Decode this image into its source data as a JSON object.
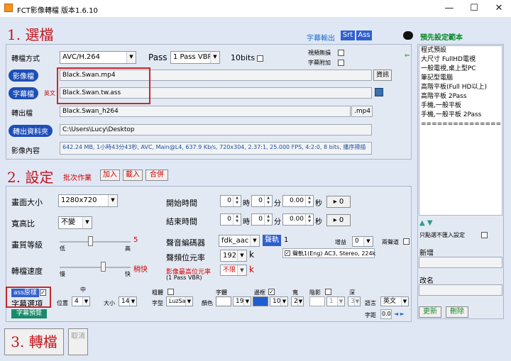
{
  "window": {
    "title": "FCT影像轉檔 版本1.6.10",
    "minimize": "—",
    "maximize": "☐",
    "close": "✕"
  },
  "section1": {
    "title": "1. 選檔",
    "subtitle_output_label": "字幕輸出",
    "srt_label": "Srt",
    "ass_label": "Ass",
    "format_label": "轉檔方式",
    "format_value": "AVC/H.264",
    "pass_label": "Pass",
    "pass_value": "1 Pass VBR",
    "bits_label": "10bits",
    "no_video_label": "視頻無損",
    "add_sub_label": "字幕附加",
    "video_file_label": "影像檔",
    "video_file_value": "Black.Swan.mp4",
    "info_button": "資訊",
    "subtitle_file_label": "字幕檔",
    "subtitle_lang": "英文",
    "subtitle_file_value": "Black.Swan.tw.ass",
    "output_file_label": "轉出檔",
    "output_file_value": "Black.Swan_h264",
    "output_ext": ".mp4",
    "output_folder_label": "轉出資料夾",
    "output_folder_value": "C:\\Users\\Lucy\\Desktop",
    "media_info_label": "影像內容",
    "media_info_value": "642.24 MB, 1小時43分43秒, AVC, Main@L4, 637.9 Kb/s, 720x304, 2.37:1, 25.000 FPS, 4:2:0, 8 bits, 播序掃描"
  },
  "presets": {
    "title": "預先設定範本",
    "items": [
      "程式預設",
      "大尺寸 FullHD電視",
      "一般電視,桌上型PC",
      "筆記型電腦",
      "高階平板(Full HD以上)",
      "高階平板 2Pass",
      "手機,一般平板",
      "手機,一般平板 2Pass",
      "==============="
    ],
    "up_down": "▲ ▼",
    "only_selected_label": "只點選不匯入設定",
    "new_label": "新增",
    "rename_label": "改名",
    "update_button": "更新",
    "delete_button": "刪除"
  },
  "section2": {
    "title": "2. 設定",
    "batch_label": "批次作業",
    "add_button": "加入",
    "load_button": "載入",
    "merge_button": "合併",
    "size_label": "畫面大小",
    "size_value": "1280x720",
    "aspect_label": "寬高比",
    "aspect_value": "不變",
    "quality_label": "畫質等級",
    "quality_value": "5",
    "low_label": "低",
    "high_label": "高",
    "speed_label": "轉檔速度",
    "speed_value": "稍快",
    "slow_label": "慢",
    "fast_label": "快",
    "start_label": "開始時間",
    "end_label": "結束時間",
    "hour": "時",
    "minute": "分",
    "second": "秒",
    "zero": "0",
    "sec_zero": "0.00",
    "go_label": "▸ 0",
    "encoder_label": "聲音編碼器",
    "encoder_value": "fdk_aac",
    "audio_track_label": "聲軌",
    "audio_track_num": "1",
    "gain_label": "增益",
    "gain_value": "0",
    "two_ch_label": "兩聲道",
    "bitrate_label": "聲頻位元率",
    "bitrate_value": "192",
    "bitrate_unit": "k",
    "audio_track_desc": "聲軌1(Eng) AC3, Stereo, 224k",
    "max_bitrate_label": "影像最高位元率",
    "max_bitrate_value": "不限",
    "max_bitrate_unit": "k",
    "max_bitrate_note": "(1 Pass VBR)",
    "ass_native_label": "ass原樣",
    "sub_options_label": "字幕選項",
    "sub_preview_button": "字幕預覽",
    "middle_label": "中",
    "position_label": "位置",
    "position_value": "4",
    "size_small_label": "大小",
    "size_small_value": "14",
    "bold_label": "粗體",
    "font_label": "字體",
    "font_type_label": "字型",
    "font_type_value": "LuzSa",
    "color_label": "顏色",
    "font_color_value": "19",
    "border_label": "邊框",
    "border_color_value": "102",
    "width_label": "寬",
    "width_value": "2",
    "shadow_label": "陰影",
    "shadow_value": "1",
    "depth_label": "深",
    "depth_value": "3",
    "lang_label": "語言",
    "lang_value": "英文",
    "spacing_label": "字距",
    "spacing_value": "0.0"
  },
  "section3": {
    "title": "3. 轉檔",
    "cancel_button": "取消"
  }
}
